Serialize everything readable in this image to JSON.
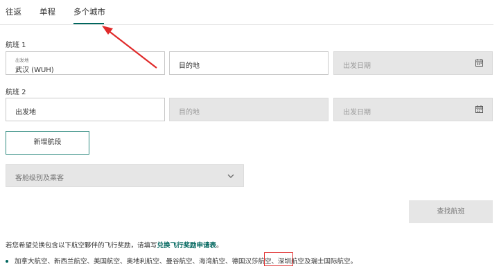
{
  "tabs": [
    {
      "label": "往返"
    },
    {
      "label": "单程"
    },
    {
      "label": "多个城市"
    }
  ],
  "active_tab": "多个城市",
  "flight1": {
    "label": "航班 1",
    "origin": {
      "small_label": "出发地",
      "value": "武汉 (WUH)"
    },
    "destination_placeholder": "目的地",
    "date_placeholder": "出发日期"
  },
  "flight2": {
    "label": "航班 2",
    "origin_placeholder": "出发地",
    "destination_placeholder": "目的地",
    "date_placeholder": "出发日期"
  },
  "add_segment_label": "新增航段",
  "cabin_placeholder": "客舱级别及乘客",
  "search_label": "查找航班",
  "notice": {
    "prefix": "若您希望兑换包含以下航空夥伴的飞行奖励，请填写",
    "link": "兑换飞行奖励申请表",
    "suffix": "。"
  },
  "partners_line": {
    "before": "加拿大航空、新西兰航空、美国航空、奥地利航空、曼谷航空、海湾航空、德国汉莎航空、",
    "highlighted": "深圳航空",
    "after": "及瑞士国际航空。"
  },
  "colors": {
    "accent": "#00665e",
    "annotation_red": "#e02a2a",
    "disabled_bg": "#e6e6e6"
  },
  "icons": {
    "calendar": "calendar-icon",
    "chevron": "chevron-down-icon"
  }
}
